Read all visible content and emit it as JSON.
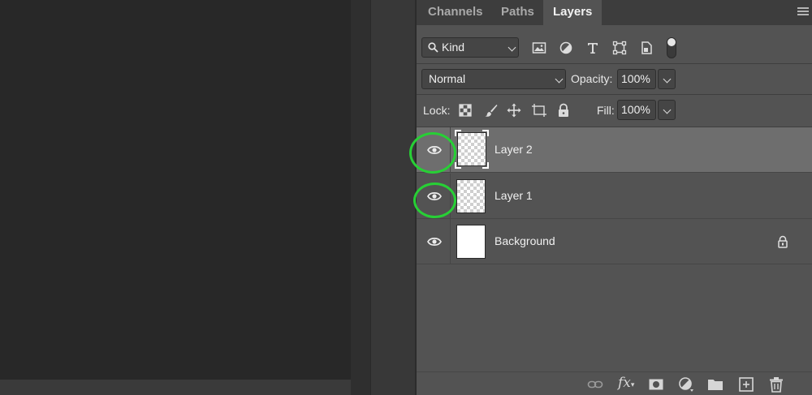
{
  "panel": {
    "tabs": [
      {
        "label": "Channels",
        "active": false
      },
      {
        "label": "Paths",
        "active": false
      },
      {
        "label": "Layers",
        "active": true
      }
    ],
    "filter": {
      "kind_label": "Kind",
      "icons": [
        "image-filter-icon",
        "adjustment-filter-icon",
        "type-filter-icon",
        "shape-filter-icon",
        "smart-object-filter-icon"
      ]
    },
    "blend_mode": "Normal",
    "opacity_label": "Opacity:",
    "opacity_value": "100%",
    "lock_label": "Lock:",
    "lock_icons": [
      "lock-transparent-pixels-icon",
      "lock-image-pixels-icon",
      "lock-position-icon",
      "lock-artboard-icon",
      "lock-all-icon"
    ],
    "fill_label": "Fill:",
    "fill_value": "100%"
  },
  "layers": [
    {
      "name": "Layer 2",
      "selected": true,
      "visible": true,
      "thumbnail": "transparent",
      "locked": false,
      "highlighted": true
    },
    {
      "name": "Layer 1",
      "selected": false,
      "visible": true,
      "thumbnail": "transparent",
      "locked": false,
      "highlighted": true
    },
    {
      "name": "Background",
      "selected": false,
      "visible": true,
      "thumbnail": "white",
      "locked": true,
      "highlighted": false
    }
  ],
  "bottom_toolbar": {
    "icons": [
      "link-layers-icon",
      "fx-icon",
      "add-mask-icon",
      "new-adjustment-layer-icon",
      "new-group-icon",
      "new-layer-icon",
      "delete-layer-icon"
    ],
    "fx_text": "fx"
  },
  "colors": {
    "panel_bg": "#535353",
    "selected_row": "#6e6e6e",
    "highlight_ring": "#27d035",
    "canvas_bg": "#282828"
  }
}
